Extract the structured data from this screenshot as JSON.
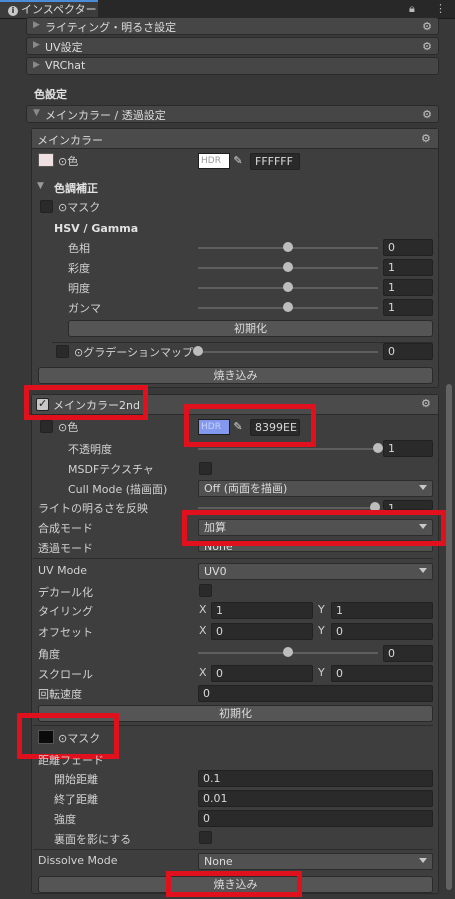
{
  "window": {
    "tab_title": "インスペクター"
  },
  "folds": [
    {
      "label": "ライティング・明るさ設定"
    },
    {
      "label": "UV設定"
    },
    {
      "label": "VRChat"
    }
  ],
  "color_settings_title": "色設定",
  "main_color_alpha_section": "メインカラー / 透過設定",
  "main_color_panel": {
    "title": "メインカラー",
    "color_label": "⊙色",
    "hdr_label": "HDR",
    "hex": "FFFFFF",
    "correction_title": "色調補正",
    "mask_label": "⊙マスク",
    "hsv_title": "HSV / Gamma",
    "sliders": [
      {
        "label": "色相",
        "value": "0",
        "pos": 0.5
      },
      {
        "label": "彩度",
        "value": "1",
        "pos": 0.5
      },
      {
        "label": "明度",
        "value": "1",
        "pos": 0.5
      },
      {
        "label": "ガンマ",
        "value": "1",
        "pos": 0.5
      }
    ],
    "reset_label": "初期化",
    "gradation_label": "⊙グラデーションマップ",
    "gradation_value": "0",
    "gradation_pos": 0.0,
    "bake_label": "焼き込み"
  },
  "main_color_2nd": {
    "title": "メインカラー2nd",
    "enabled": true,
    "color_label": "⊙色",
    "hdr_label": "HDR",
    "hex": "8399EE",
    "swatch_color": "#8399ee",
    "opacity_label": "不透明度",
    "opacity_value": "1",
    "opacity_pos": 1.0,
    "msdf_label": "MSDFテクスチャ",
    "cull_label": "Cull Mode (描画面)",
    "cull_value": "Off (両面を描画)",
    "light_label": "ライトの明るさを反映",
    "light_value": "1",
    "blend_label": "合成モード",
    "blend_value": "加算",
    "alpha_label": "透過モード",
    "alpha_value": "None",
    "uv_label": "UV Mode",
    "uv_value": "UV0",
    "decal_label": "デカール化",
    "tiling_label": "タイリング",
    "tiling_x": "1",
    "tiling_y": "1",
    "offset_label": "オフセット",
    "offset_x": "0",
    "offset_y": "0",
    "angle_label": "角度",
    "angle_value": "0",
    "angle_pos": 0.5,
    "scroll_label": "スクロール",
    "scroll_x": "0",
    "scroll_y": "0",
    "rotation_label": "回転速度",
    "rotation_value": "0",
    "reset_label": "初期化",
    "mask_label": "⊙マスク",
    "distance_fade_label": "距離フェード",
    "fade_start_label": "開始距離",
    "fade_start_value": "0.1",
    "fade_end_label": "終了距離",
    "fade_end_value": "0.01",
    "strength_label": "強度",
    "strength_value": "0",
    "backface_label": "裏面を影にする",
    "dissolve_label": "Dissolve Mode",
    "dissolve_value": "None",
    "bake_label": "焼き込み",
    "x_label": "X",
    "y_label": "Y"
  },
  "colors": {
    "highlight": "#e0101c",
    "background": "#383838"
  }
}
